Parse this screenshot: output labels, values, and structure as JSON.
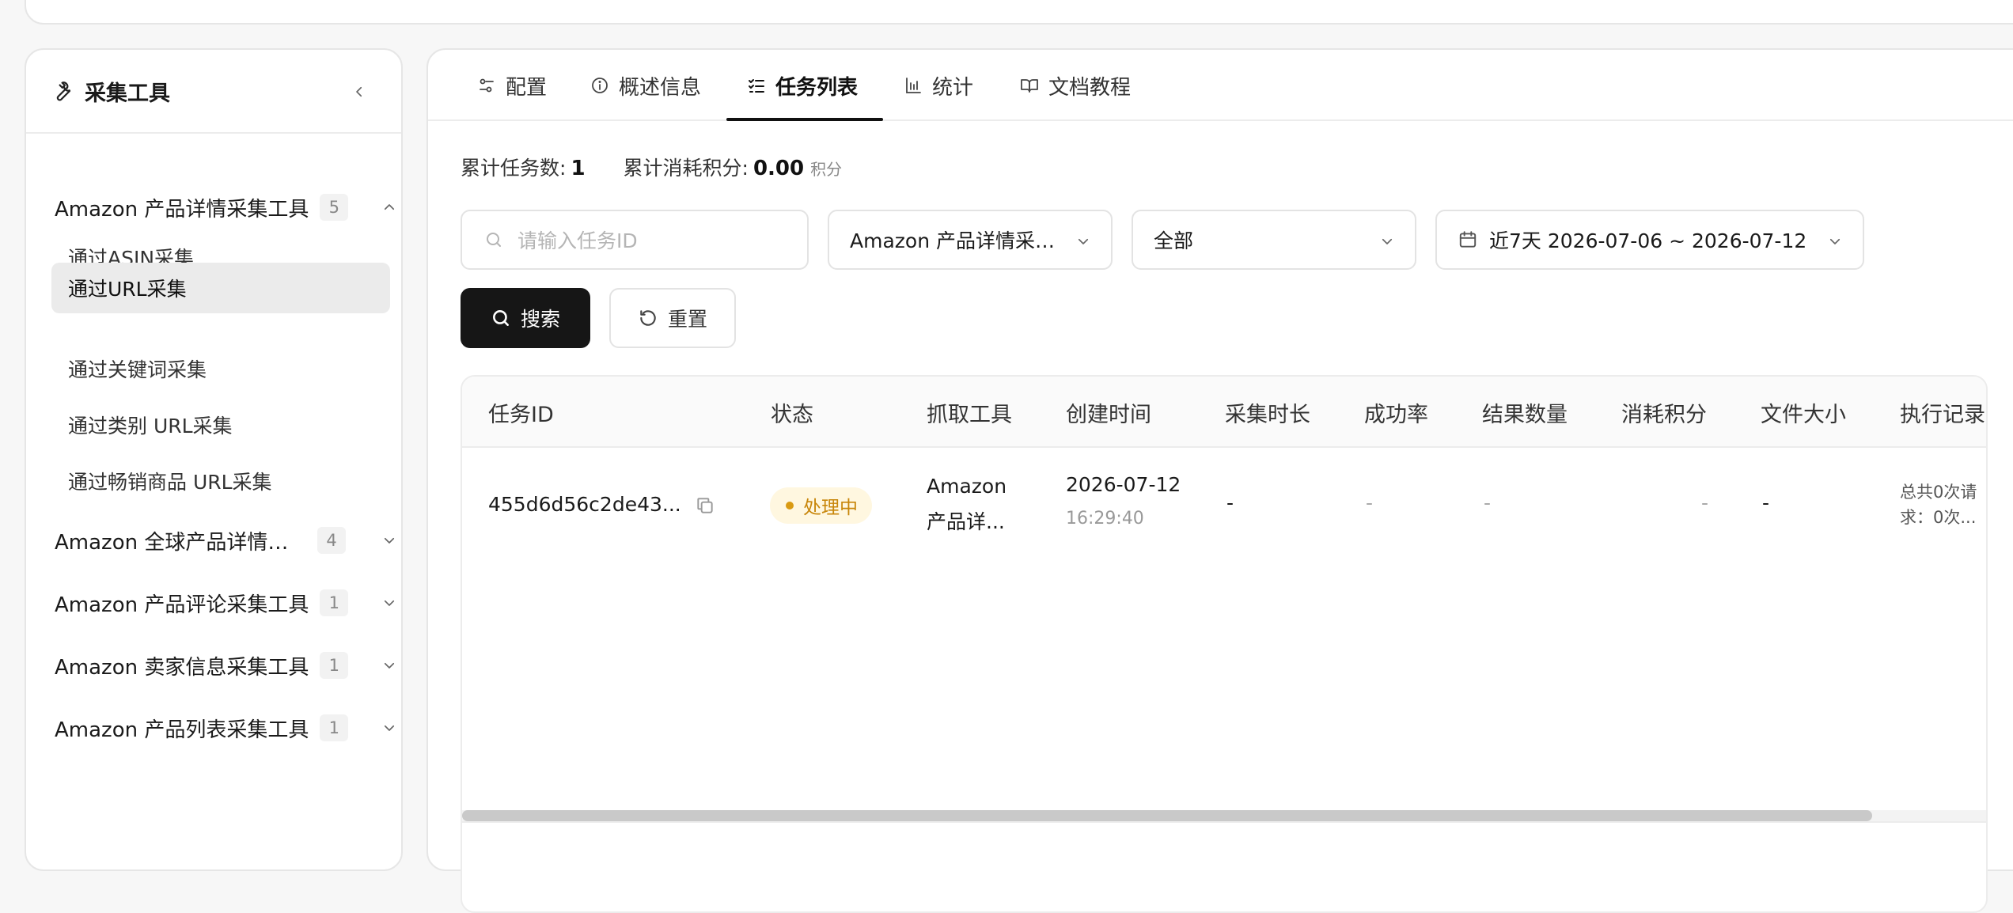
{
  "sidebar": {
    "title": "采集工具",
    "groups": [
      {
        "name": "Amazon 产品详情采集工具",
        "count": "5",
        "expanded": true,
        "items": [
          {
            "label": "通过ASIN采集",
            "active": false
          },
          {
            "label": "通过URL采集",
            "active": true
          },
          {
            "label": "通过关键词采集",
            "active": false
          },
          {
            "label": "通过类别 URL采集",
            "active": false
          },
          {
            "label": "通过畅销商品 URL采集",
            "active": false
          }
        ]
      },
      {
        "name": "Amazon 全球产品详情采集工具",
        "count": "4",
        "expanded": false
      },
      {
        "name": "Amazon 产品评论采集工具",
        "count": "1",
        "expanded": false
      },
      {
        "name": "Amazon 卖家信息采集工具",
        "count": "1",
        "expanded": false
      },
      {
        "name": "Amazon 产品列表采集工具",
        "count": "1",
        "expanded": false
      }
    ]
  },
  "tabs": [
    {
      "label": "配置",
      "icon": "sliders-icon",
      "active": false
    },
    {
      "label": "概述信息",
      "icon": "info-icon",
      "active": false
    },
    {
      "label": "任务列表",
      "icon": "checklist-icon",
      "active": true
    },
    {
      "label": "统计",
      "icon": "bar-chart-icon",
      "active": false
    },
    {
      "label": "文档教程",
      "icon": "book-icon",
      "active": false
    }
  ],
  "summary": {
    "task_count_label": "累计任务数:",
    "task_count": "1",
    "points_label": "累计消耗积分:",
    "points": "0.00",
    "points_unit": "积分"
  },
  "filters": {
    "task_id_placeholder": "请输入任务ID",
    "tool_value": "Amazon 产品详情采集工具",
    "status_value": "全部",
    "date_value": "近7天 2026-07-06 ~ 2026-07-12"
  },
  "buttons": {
    "search": "搜索",
    "reset": "重置"
  },
  "table": {
    "columns": [
      "任务ID",
      "状态",
      "抓取工具",
      "创建时间",
      "采集时长",
      "成功率",
      "结果数量",
      "消耗积分",
      "文件大小",
      "执行记录"
    ],
    "rows": [
      {
        "task_id": "455d6d56c2de43...",
        "status": "处理中",
        "tool_line1": "Amazon",
        "tool_line2": "产品详...",
        "created_date": "2026-07-12",
        "created_time": "16:29:40",
        "duration": "-",
        "success_rate": "-",
        "result_count": "-",
        "points": "-",
        "file_size": "-",
        "log_line1": "总共0次请",
        "log_line2": "求：0次..."
      }
    ]
  },
  "colors": {
    "primary": "#161616",
    "status_processing_bg": "#fff7e0",
    "status_processing_text": "#c8860a",
    "active_item_bg": "#ebebeb"
  }
}
